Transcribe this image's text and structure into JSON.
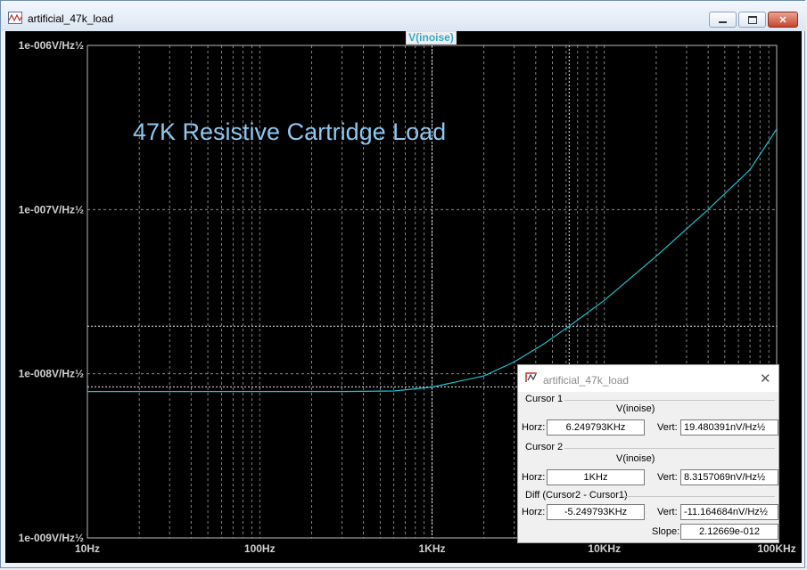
{
  "window": {
    "title": "artificial_47k_load"
  },
  "trace_label": "V(inoise)",
  "annotation": "47K Resistive Cartridge Load",
  "colors": {
    "background": "#000000",
    "trace": "#1fc4cf",
    "annotation": "#8ec7ef",
    "grid": "#a0a0a0",
    "axis_text": "#d0d0d0"
  },
  "chart_data": {
    "type": "line",
    "x_scale": "log",
    "y_scale": "log",
    "xlim": [
      10,
      100000
    ],
    "ylim": [
      1e-09,
      1e-06
    ],
    "x_ticks": [
      {
        "v": 10,
        "label": "10Hz"
      },
      {
        "v": 100,
        "label": "100Hz"
      },
      {
        "v": 1000,
        "label": "1KHz"
      },
      {
        "v": 10000,
        "label": "10KHz"
      },
      {
        "v": 100000,
        "label": "100KHz"
      }
    ],
    "y_ticks": [
      {
        "v": 1e-06,
        "label": "1e-006V/Hz½"
      },
      {
        "v": 1e-07,
        "label": "1e-007V/Hz½"
      },
      {
        "v": 1e-08,
        "label": "1e-008V/Hz½"
      },
      {
        "v": 1e-09,
        "label": "1e-009V/Hz½"
      }
    ],
    "grid": true,
    "series": [
      {
        "name": "V(inoise)",
        "points": [
          [
            10,
            7.8e-09
          ],
          [
            100,
            7.8e-09
          ],
          [
            300,
            7.8e-09
          ],
          [
            600,
            7.85e-09
          ],
          [
            1000,
            8.3e-09
          ],
          [
            2000,
            9.7e-09
          ],
          [
            3000,
            1.18e-08
          ],
          [
            4500,
            1.53e-08
          ],
          [
            6250,
            1.95e-08
          ],
          [
            10000,
            2.8e-08
          ],
          [
            20000,
            5.2e-08
          ],
          [
            40000,
            1e-07
          ],
          [
            70000,
            1.75e-07
          ],
          [
            100000,
            3.1e-07
          ]
        ]
      }
    ],
    "cursors": [
      {
        "x": 6249.793,
        "y": 1.9480391e-08
      },
      {
        "x": 1000,
        "y": 8.3157069e-09
      }
    ]
  },
  "cursor_dialog": {
    "title": "artificial_47k_load",
    "cursor1": {
      "heading": "Cursor 1",
      "trace": "V(inoise)",
      "horz_label": "Horz:",
      "horz": "6.249793KHz",
      "vert_label": "Vert:",
      "vert": "19.480391nV/Hz½"
    },
    "cursor2": {
      "heading": "Cursor 2",
      "trace": "V(inoise)",
      "horz_label": "Horz:",
      "horz": "1KHz",
      "vert_label": "Vert:",
      "vert": "8.3157069nV/Hz½"
    },
    "diff": {
      "heading": "Diff (Cursor2 - Cursor1)",
      "horz_label": "Horz:",
      "horz": "-5.249793KHz",
      "vert_label": "Vert:",
      "vert": "-11.164684nV/Hz½",
      "slope_label": "Slope:",
      "slope": "2.12669e-012"
    }
  }
}
